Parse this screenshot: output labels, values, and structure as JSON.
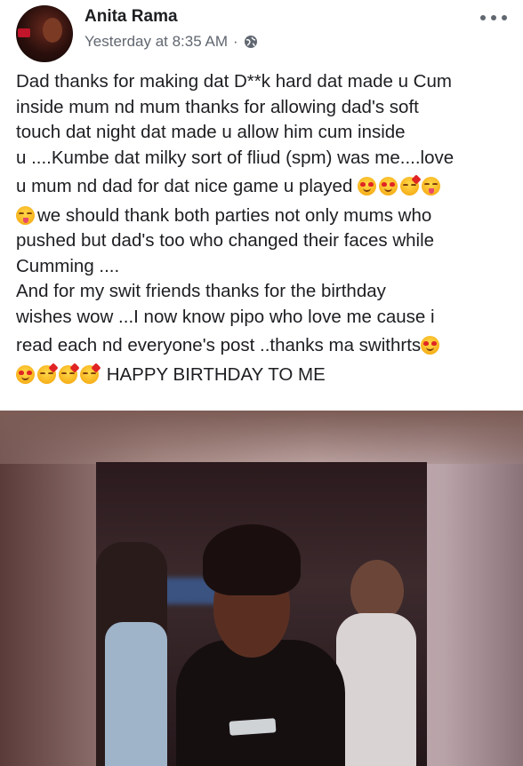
{
  "post": {
    "author": "Anita Rama",
    "timestamp": "Yesterday at 8:35 AM",
    "separator": "·",
    "privacy_icon": "globe-icon",
    "more_icon": "more-options-icon",
    "lines": {
      "l1": "Dad thanks for making dat D**k  hard dat made u Cum",
      "l2": "inside mum nd  mum thanks for allowing dad's soft",
      "l3": "touch dat night dat made u allow him cum inside",
      "l4": "u ....Kumbe dat milky sort of fliud (spm) was me....love",
      "l5": "u mum nd dad for dat nice game u played",
      "l6": "we should thank both parties not only mums who",
      "l7": "pushed but dad's too who changed their faces while",
      "l8": "Cumming ....",
      "l9": "And for my swit friends thanks for the birthday",
      "l10": "wishes wow ...I now know pipo who love me cause i",
      "l11": "read each nd everyone's post ..thanks ma swithrts",
      "l12": "HAPPY BIRTHDAY TO ME"
    },
    "emojis": [
      "heart-eyes-emoji",
      "kissing-heart-emoji",
      "tongue-out-emoji"
    ]
  },
  "colors": {
    "text": "#1c1e21",
    "meta": "#616770",
    "background": "#ffffff"
  }
}
